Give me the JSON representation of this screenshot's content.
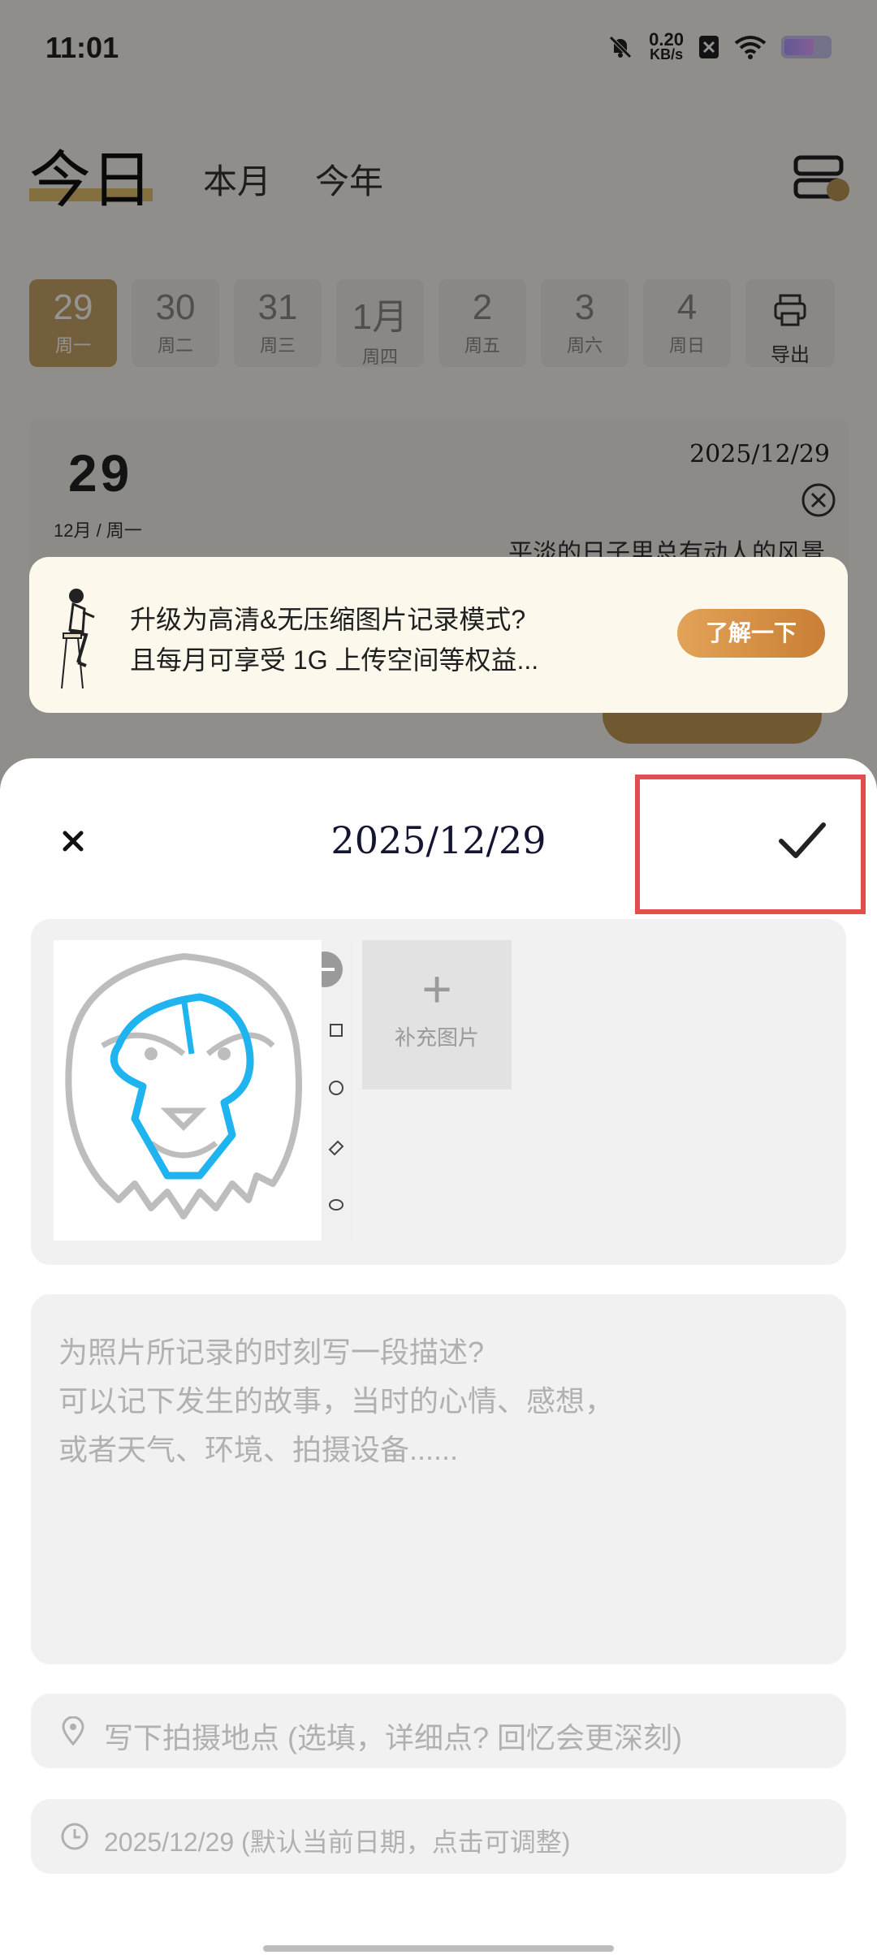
{
  "status_bar": {
    "time": "11:01",
    "net_speed": "0.20",
    "net_unit": "KB/s"
  },
  "nav": {
    "tab_today": "今日",
    "tab_month": "本月",
    "tab_year": "今年"
  },
  "days": [
    {
      "num": "29",
      "weekday": "周一",
      "active": true
    },
    {
      "num": "30",
      "weekday": "周二"
    },
    {
      "num": "31",
      "weekday": "周三"
    },
    {
      "num": "1月",
      "weekday": "周四"
    },
    {
      "num": "2",
      "weekday": "周五"
    },
    {
      "num": "3",
      "weekday": "周六"
    },
    {
      "num": "4",
      "weekday": "周日"
    }
  ],
  "export_label": "导出",
  "day_card": {
    "day": "29",
    "sub": "12月 / 周一",
    "date": "2025/12/29",
    "quote": "平淡的日子里总有动人的风景"
  },
  "promo": {
    "line1": "升级为高清&无压缩图片记录模式?",
    "line2": "且每月可享受 1G 上传空间等权益...",
    "button": "了解一下"
  },
  "sheet": {
    "title": "2025/12/29",
    "add_image_label": "补充图片",
    "description_placeholder_1": "为照片所记录的时刻写一段描述?",
    "description_placeholder_2": "可以记下发生的故事，当时的心情、感想，",
    "description_placeholder_3": "或者天气、环境、拍摄设备......",
    "location_placeholder": "写下拍摄地点 (选填，详细点? 回忆会更深刻)",
    "date_hint": "2025/12/29 (默认当前日期，点击可调整)"
  },
  "colors": {
    "accent_gold": "#c9a468",
    "highlight_red": "#e24d4d",
    "sketch_blue": "#1fb4ef"
  }
}
